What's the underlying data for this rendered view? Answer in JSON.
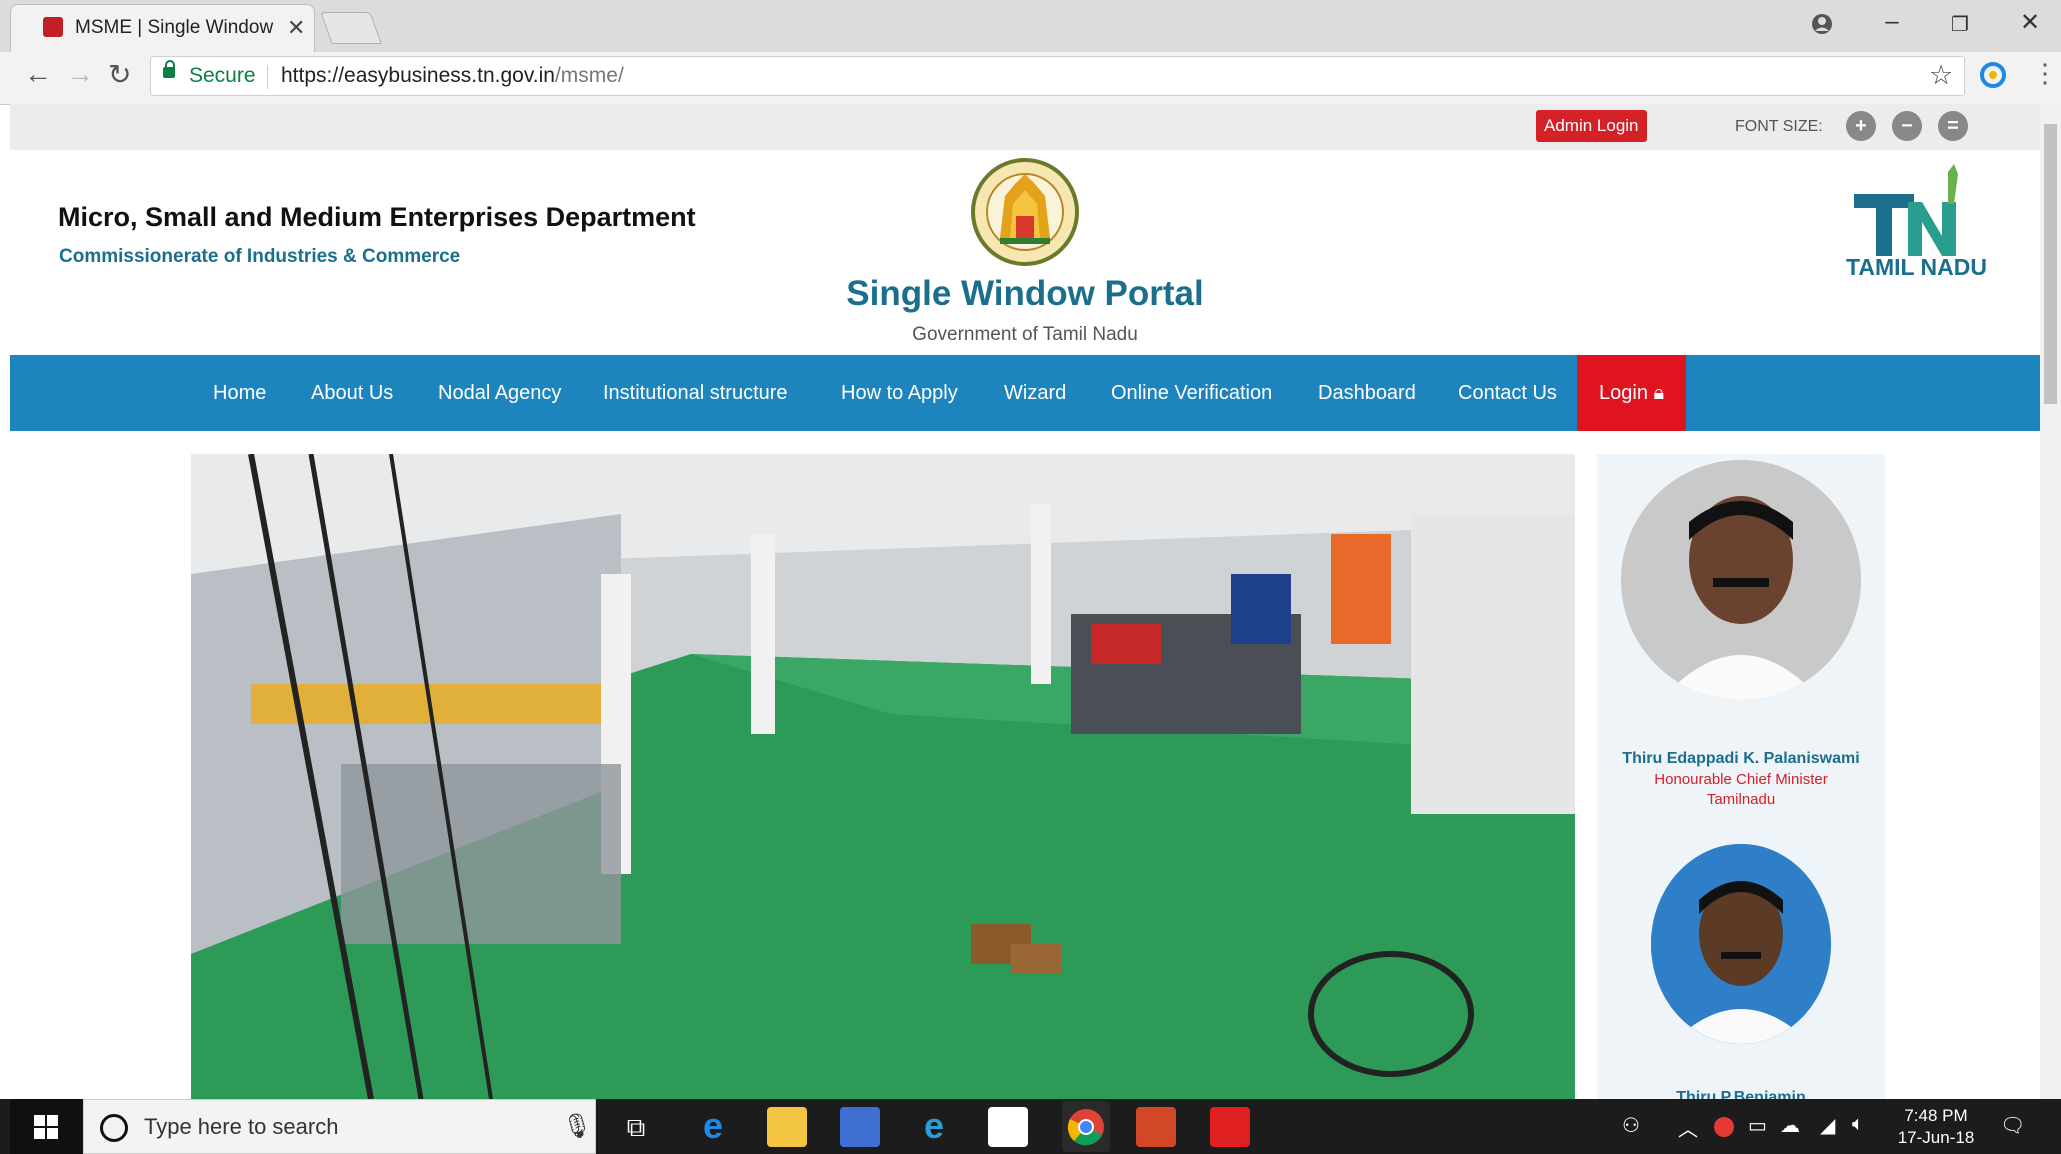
{
  "browser": {
    "tab_title": "MSME | Single Window",
    "security_label": "Secure",
    "url_base": "https://easybusiness.tn.gov.in",
    "url_path": "/msme/"
  },
  "top_strip": {
    "admin_login": "Admin Login",
    "font_size_label": "FONT SIZE:",
    "increase": "+",
    "decrease": "−",
    "reset": "="
  },
  "header": {
    "department": "Micro, Small and Medium Enterprises Department",
    "commissionerate": "Commissionerate of Industries & Commerce",
    "portal_title": "Single Window Portal",
    "government": "Government of Tamil Nadu",
    "state_logo_text": "TAMIL NADU"
  },
  "nav": {
    "items": [
      "Home",
      "About Us",
      "Nodal Agency",
      "Institutional structure",
      "How to Apply",
      "Wizard",
      "Online Verification",
      "Dashboard",
      "Contact Us"
    ],
    "login": "Login"
  },
  "sidebar": {
    "person1_name": "Thiru Edappadi K. Palaniswami",
    "person1_role1": "Honourable Chief Minister",
    "person1_role2": "Tamilnadu",
    "person2_name": "Thiru P.Benjamin"
  },
  "taskbar": {
    "search_placeholder": "Type here to search",
    "time": "7:48 PM",
    "date": "17-Jun-18"
  },
  "colors": {
    "nav_bg": "#1d84bd",
    "login_bg": "#e0141e",
    "accent": "#1b6f8c"
  }
}
